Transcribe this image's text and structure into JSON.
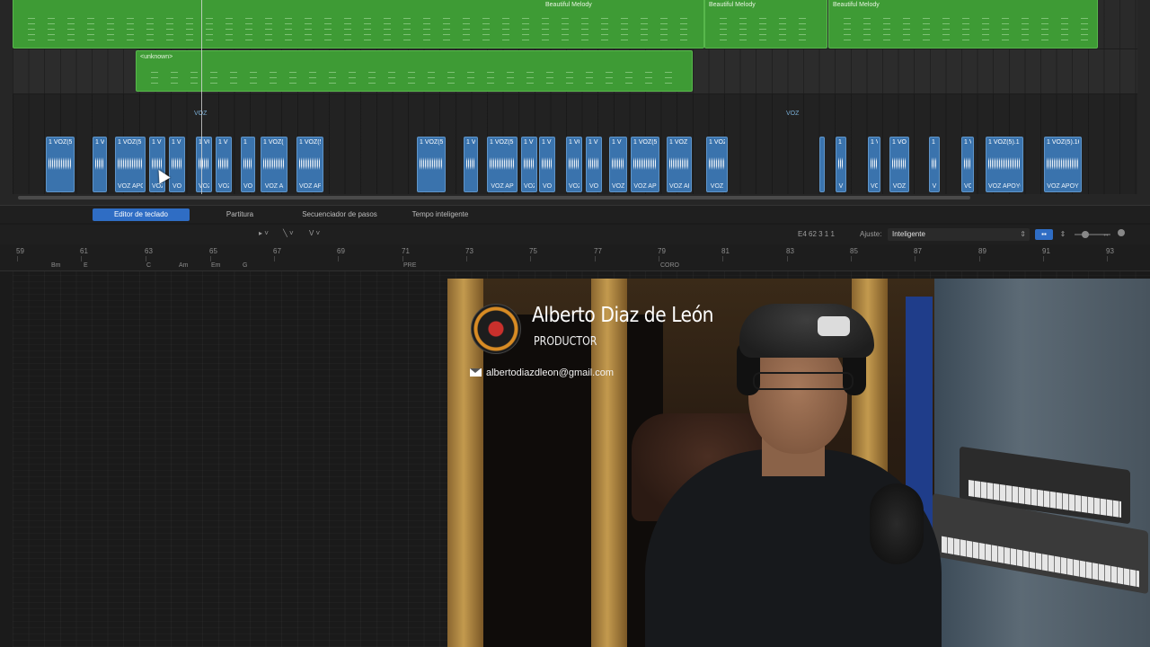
{
  "tracks": {
    "region_beautiful_1": "Beautiful Melody",
    "region_beautiful_2": "Beautiful Melody",
    "region_beautiful_3": "Beautiful Melody",
    "region_unknown": "<unknown>",
    "voz_marker_1": "VOZ",
    "voz_marker_2": "VOZ",
    "audio_regions": [
      {
        "top": "1 VOZ(5",
        "bottom": ""
      },
      {
        "top": "1 V",
        "bottom": ""
      },
      {
        "top": "1 VOZ(5",
        "bottom": "VOZ APO"
      },
      {
        "top": "1 V",
        "bottom": "VOZ"
      },
      {
        "top": "1 V",
        "bottom": "VO"
      },
      {
        "top": "1 VO",
        "bottom": "VOZ"
      },
      {
        "top": "1 V",
        "bottom": "VOZ"
      },
      {
        "top": "1",
        "bottom": "VOZ"
      },
      {
        "top": "1 VOZ(",
        "bottom": "VOZ A"
      },
      {
        "top": "1 VOZ(5",
        "bottom": "VOZ AP"
      },
      {
        "top": "1 VOZ(5",
        "bottom": ""
      },
      {
        "top": "1 V",
        "bottom": ""
      },
      {
        "top": "1 VOZ(5",
        "bottom": "VOZ AP"
      },
      {
        "top": "1 V",
        "bottom": "VOZ"
      },
      {
        "top": "1 V",
        "bottom": "VO"
      },
      {
        "top": "1 VO",
        "bottom": "VOZ"
      },
      {
        "top": "1 V",
        "bottom": "VO"
      },
      {
        "top": "1 V",
        "bottom": "VOZ"
      },
      {
        "top": "1 VOZ(5",
        "bottom": "VOZ AP"
      },
      {
        "top": "1 VOZ",
        "bottom": "VOZ AP"
      },
      {
        "top": "1 VOZ",
        "bottom": "VOZ"
      },
      {
        "top": "1",
        "bottom": ""
      },
      {
        "top": "1 V",
        "bottom": "V"
      },
      {
        "top": "1 V",
        "bottom": "VO"
      },
      {
        "top": "1 VO",
        "bottom": "VOZ"
      },
      {
        "top": "1",
        "bottom": "V"
      },
      {
        "top": "1 V",
        "bottom": "VO"
      },
      {
        "top": "1 VOZ(5).1",
        "bottom": "VOZ APOYO"
      },
      {
        "top": "1 VOZ(5).16",
        "bottom": "VOZ APOY"
      }
    ]
  },
  "editor_tabs": {
    "piano_roll": "Editor de teclado",
    "score": "Partitura",
    "step_sequencer": "Secuenciador de pasos",
    "smart_tempo": "Tempo inteligente"
  },
  "toolbar": {
    "pointer_tool": "▸ ˅",
    "pencil_tool": "╲ ˅",
    "velocity_tool": "V ˅",
    "position": "E4   62 3 1 1",
    "snap_label": "Ajuste:",
    "snap_value": "Inteligente"
  },
  "ruler": {
    "bars": [
      "59",
      "61",
      "63",
      "65",
      "67",
      "69",
      "71",
      "73",
      "75",
      "77",
      "79",
      "81",
      "83",
      "85",
      "87",
      "89",
      "91",
      "93"
    ],
    "chords": [
      "Bm",
      "E",
      "C",
      "Am",
      "Em",
      "G"
    ],
    "markers": [
      "PRE",
      "CORO"
    ]
  },
  "overlay": {
    "name": "Alberto Diaz de León",
    "role": "PRODUCTOR",
    "email": "albertodiazdleon@gmail.com"
  },
  "colors": {
    "midi_region": "#3e9b35",
    "audio_region": "#3a73ad",
    "active_tab": "#2f6dc4"
  }
}
